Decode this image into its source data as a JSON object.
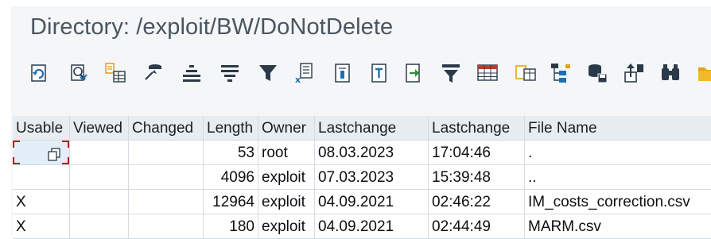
{
  "window": {
    "title": "Directory: /exploit/BW/DoNotDelete"
  },
  "toolbar": {
    "buttons": [
      {
        "name": "refresh-icon"
      },
      {
        "name": "details-icon"
      },
      {
        "name": "select-layout-icon"
      },
      {
        "name": "sort-ascending-icon"
      },
      {
        "name": "align-center-icon"
      },
      {
        "name": "align-lines-icon"
      },
      {
        "name": "filter-icon"
      },
      {
        "name": "export-excel-icon"
      },
      {
        "name": "document-icon"
      },
      {
        "name": "text-icon"
      },
      {
        "name": "export-icon"
      },
      {
        "name": "filter-settings-icon"
      },
      {
        "name": "spreadsheet-icon"
      },
      {
        "name": "layout-change-icon"
      },
      {
        "name": "hierarchy-icon"
      },
      {
        "name": "database-save-icon"
      },
      {
        "name": "upload-icon"
      },
      {
        "name": "binoculars-icon"
      },
      {
        "name": "folder-icon"
      }
    ]
  },
  "table": {
    "columns": [
      "Usable",
      "Viewed",
      "Changed",
      "Length",
      "Owner",
      "Lastchange",
      "Lastchange",
      "File Name"
    ],
    "rows": [
      {
        "usable": "",
        "viewed": "",
        "changed": "",
        "length": "53",
        "owner": "root",
        "date": "08.03.2023",
        "time": "17:04:46",
        "file": "."
      },
      {
        "usable": "",
        "viewed": "",
        "changed": "",
        "length": "4096",
        "owner": "exploit",
        "date": "07.03.2023",
        "time": "15:39:48",
        "file": ".."
      },
      {
        "usable": "X",
        "viewed": "",
        "changed": "",
        "length": "12964",
        "owner": "exploit",
        "date": "04.09.2021",
        "time": "02:46:22",
        "file": "IM_costs_correction.csv"
      },
      {
        "usable": "X",
        "viewed": "",
        "changed": "",
        "length": "180",
        "owner": "exploit",
        "date": "04.09.2021",
        "time": "02:44:49",
        "file": "MARM.csv"
      }
    ]
  },
  "colors": {
    "icon_blue": "#1f6fb2",
    "icon_dark": "#2b3a4a",
    "icon_orange": "#e3a30f",
    "title": "#4a5560",
    "selection": "#b02020"
  }
}
